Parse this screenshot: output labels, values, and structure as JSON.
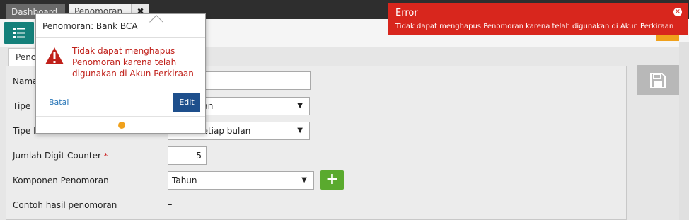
{
  "tabs": {
    "dashboard": "Dashboard",
    "penomoran": "Penomoran",
    "close": "✖"
  },
  "form": {
    "subtab": "Penomoran",
    "labels": {
      "nama": "Nama",
      "tipe_transaksi": "Tipe Transaksi",
      "tipe_reset": "Tipe Reset",
      "jumlah_digit": "Jumlah Digit Counter",
      "komponen": "Komponen Penomoran",
      "contoh": "Contoh hasil penomoran"
    },
    "required_marker": "*",
    "values": {
      "tipe_transaksi": "Penjualan",
      "tipe_reset": "Reset setiap bulan",
      "jumlah_digit": "5",
      "komponen": "Tahun",
      "contoh": "–"
    },
    "add_label": "+"
  },
  "popover": {
    "title": "Penomoran: Bank BCA",
    "message": "Tidak dapat menghapus Penomoran karena telah digunakan di Akun Perkiraan",
    "cancel": "Batal",
    "edit": "Edit"
  },
  "toast": {
    "title": "Error",
    "message": "Tidak dapat menghapus Penomoran karena telah digunakan di Akun Perkiraan",
    "close": "✕"
  },
  "colors": {
    "accent_teal": "#14807a",
    "error_red": "#d8261d",
    "primary_blue": "#1e4f8c",
    "add_green": "#5aaa2e",
    "indicator_orange": "#f0a11c"
  },
  "icons": {
    "menu": "list-icon",
    "save": "floppy-disk-icon",
    "warning": "warning-triangle-icon",
    "close": "close-icon"
  }
}
